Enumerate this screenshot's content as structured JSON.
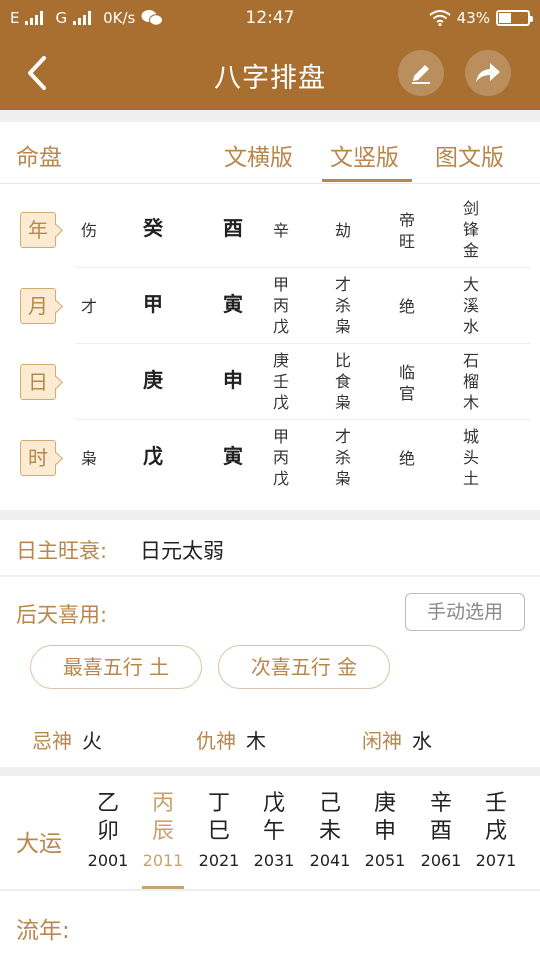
{
  "statusbar": {
    "network1": "E",
    "network2": "G",
    "speed": "0K/s",
    "time": "12:47",
    "battery": "43%",
    "battery_level": 0.43
  },
  "header": {
    "title": "八字排盘"
  },
  "tabs": {
    "section_label": "命盘",
    "items": [
      "文横版",
      "文竖版",
      "图文版"
    ],
    "active_index": 1
  },
  "chart": {
    "rows": [
      {
        "pillar": "年",
        "tenGod": "伤",
        "stem": "癸",
        "branch": "酉",
        "hidden": "辛",
        "hiddenGods": "劫",
        "stage": "帝旺",
        "nayin": "剑锋金"
      },
      {
        "pillar": "月",
        "tenGod": "才",
        "stem": "甲",
        "branch": "寅",
        "hidden": "甲丙戊",
        "hiddenGods": "才杀枭",
        "stage": "绝",
        "nayin": "大溪水"
      },
      {
        "pillar": "日",
        "tenGod": "",
        "stem": "庚",
        "branch": "申",
        "hidden": "庚壬戊",
        "hiddenGods": "比食枭",
        "stage": "临官",
        "nayin": "石榴木"
      },
      {
        "pillar": "时",
        "tenGod": "枭",
        "stem": "戊",
        "branch": "寅",
        "hidden": "甲丙戊",
        "hiddenGods": "才杀枭",
        "stage": "绝",
        "nayin": "城头土"
      }
    ]
  },
  "rizhu": {
    "label": "日主旺衰:",
    "value": "日元太弱"
  },
  "xiyong": {
    "label": "后天喜用:",
    "manual_btn": "手动选用",
    "best": "最喜五行  土",
    "second": "次喜五行  金",
    "gods": [
      {
        "label": "忌神",
        "value": "火"
      },
      {
        "label": "仇神",
        "value": "木"
      },
      {
        "label": "闲神",
        "value": "水"
      }
    ]
  },
  "dayun": {
    "label": "大运",
    "active_index": 1,
    "items": [
      {
        "stem": "乙",
        "branch": "卯",
        "year": "2001"
      },
      {
        "stem": "丙",
        "branch": "辰",
        "year": "2011"
      },
      {
        "stem": "丁",
        "branch": "巳",
        "year": "2021"
      },
      {
        "stem": "戊",
        "branch": "午",
        "year": "2031"
      },
      {
        "stem": "己",
        "branch": "未",
        "year": "2041"
      },
      {
        "stem": "庚",
        "branch": "申",
        "year": "2051"
      },
      {
        "stem": "辛",
        "branch": "酉",
        "year": "2061"
      },
      {
        "stem": "壬",
        "branch": "戌",
        "year": "2071"
      }
    ]
  },
  "liunian": {
    "label": "流年:"
  },
  "colors": {
    "brand": "#a86f30",
    "accent": "#b8874c",
    "active": "#c9a26e"
  }
}
